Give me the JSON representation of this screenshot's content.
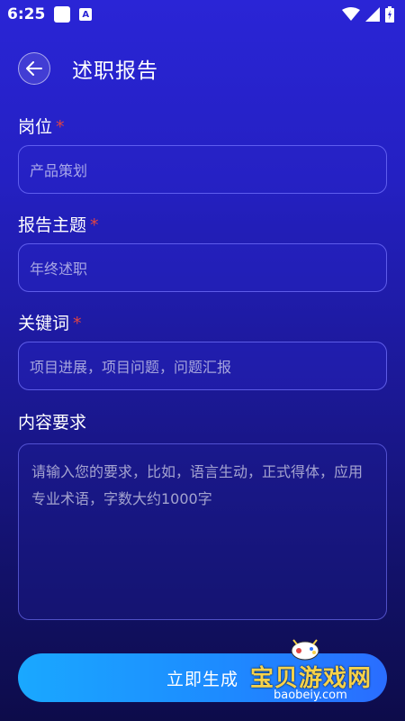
{
  "status_bar": {
    "time": "6:25",
    "app_badge": "A"
  },
  "header": {
    "title": "述职报告"
  },
  "form": {
    "required_mark": "*",
    "position": {
      "label": "岗位",
      "placeholder": "产品策划"
    },
    "report_topic": {
      "label": "报告主题",
      "placeholder": "年终述职"
    },
    "keywords": {
      "label": "关键词",
      "placeholder": "项目进展，项目问题，问题汇报"
    },
    "content_requirements": {
      "label": "内容要求",
      "placeholder": "请输入您的要求，比如，语言生动，正式得体，应用专业术语，字数大约1000字"
    }
  },
  "submit": {
    "label": "立即生成"
  },
  "watermark": {
    "text": "宝贝游戏网",
    "url": "baobeiy.com"
  }
}
